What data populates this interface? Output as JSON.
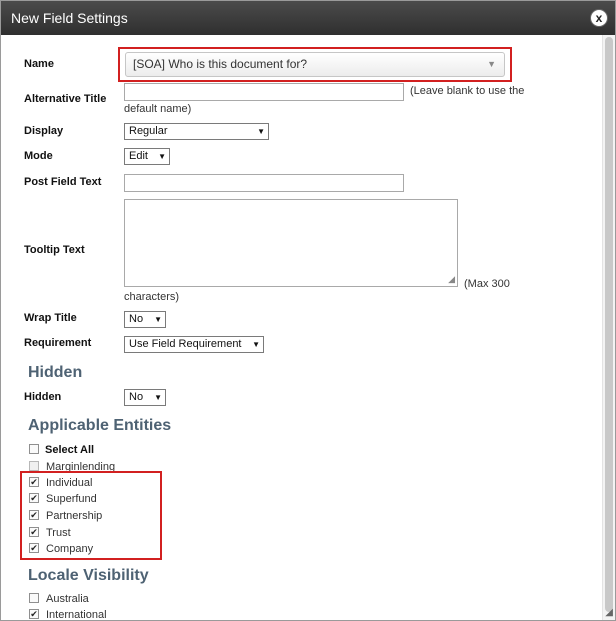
{
  "dialog": {
    "title": "New Field Settings",
    "close_label": "x"
  },
  "fields": {
    "name_label": "Name",
    "name_value": "[SOA] Who is this document for?",
    "alt_title_label": "Alternative Title",
    "alt_title_hint_1": "(Leave blank to use the",
    "alt_title_hint_2": "default name)",
    "display_label": "Display",
    "display_value": "Regular",
    "mode_label": "Mode",
    "mode_value": "Edit",
    "post_field_label": "Post Field Text",
    "tooltip_label": "Tooltip Text",
    "tooltip_hint_1": "(Max 300",
    "tooltip_hint_2": "characters)",
    "wrap_title_label": "Wrap Title",
    "wrap_title_value": "No",
    "requirement_label": "Requirement",
    "requirement_value": "Use Field Requirement"
  },
  "hidden_section": {
    "heading": "Hidden",
    "label": "Hidden",
    "value": "No"
  },
  "entities": {
    "heading": "Applicable Entities",
    "select_all": "Select All",
    "items": [
      {
        "label": "Marginlending",
        "checked": false
      },
      {
        "label": "Individual",
        "checked": true
      },
      {
        "label": "Superfund",
        "checked": true
      },
      {
        "label": "Partnership",
        "checked": true
      },
      {
        "label": "Trust",
        "checked": true
      },
      {
        "label": "Company",
        "checked": true
      }
    ]
  },
  "locale": {
    "heading": "Locale Visibility",
    "items": [
      {
        "label": "Australia",
        "checked": false
      },
      {
        "label": "International",
        "checked": true
      }
    ]
  },
  "colors": {
    "title_bar": "#3a3a3a",
    "section_heading": "#4e6273",
    "highlight": "#d22020"
  }
}
